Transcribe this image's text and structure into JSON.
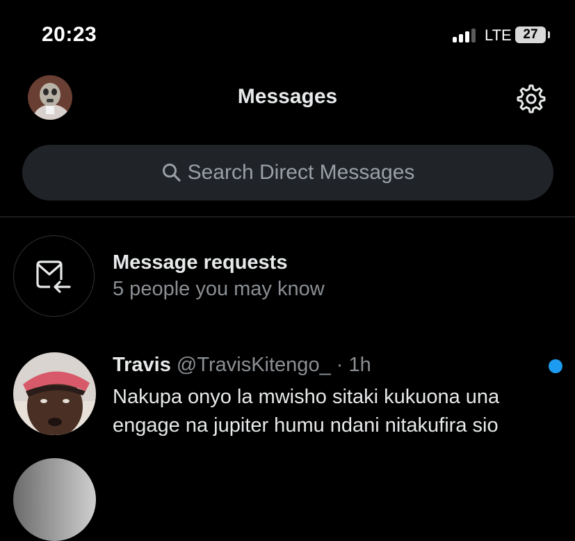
{
  "status": {
    "time": "20:23",
    "network": "LTE",
    "battery": "27"
  },
  "header": {
    "title": "Messages",
    "settings_icon": "gear-icon",
    "avatar_icon": "user-avatar"
  },
  "search": {
    "placeholder": "Search Direct Messages",
    "icon": "search-icon"
  },
  "requests": {
    "title": "Message requests",
    "subtitle": "5 people you may know",
    "icon": "mail-return-icon"
  },
  "conversations": [
    {
      "name": "Travis",
      "handle": "@TravisKitengo_",
      "separator": " · ",
      "time": "1h",
      "message": "Nakupa onyo la mwisho sitaki kukuona una engage na jupiter humu ndani nitakufira sio",
      "unread": true
    }
  ],
  "colors": {
    "background": "#000000",
    "accent": "#1d9bf0",
    "search_bg": "#202327",
    "secondary_text": "#8b8f93"
  }
}
